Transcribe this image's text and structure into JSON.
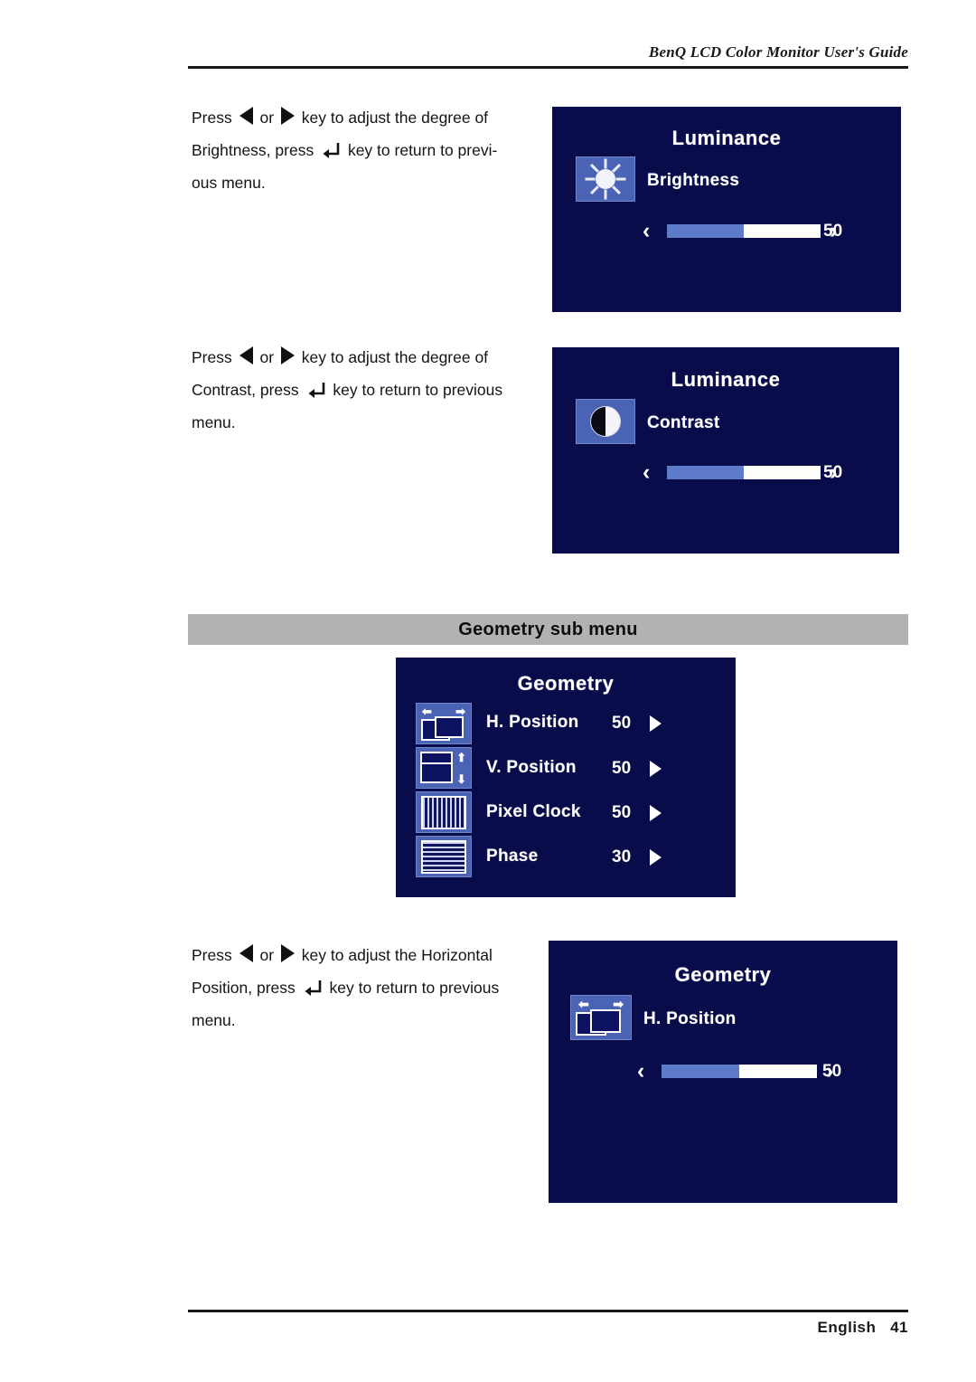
{
  "document": {
    "header_title": "BenQ LCD Color Monitor User's Guide",
    "footer_language": "English",
    "footer_page": "41"
  },
  "section": {
    "banner_title": "Geometry sub menu"
  },
  "instructions": [
    {
      "id": "brightness",
      "line1_before": "Press",
      "left_key": "left-arrow-key",
      "or": "or",
      "right_key": "right-arrow-key",
      "line1_after": "key to adjust the degree of",
      "line2_before": "Brightness, press",
      "return_key": "return-key",
      "line2_after": "key to return to previ-",
      "line3": "ous menu."
    },
    {
      "id": "contrast",
      "line1_before": "Press",
      "left_key": "left-arrow-key",
      "or": "or",
      "right_key": "right-arrow-key",
      "line1_after": "key to adjust the degree of",
      "line2_before": "Contrast, press",
      "return_key": "return-key",
      "line2_after": "key to return to previous",
      "line3": "menu."
    },
    {
      "id": "h-position",
      "line1_before": "Press",
      "left_key": "left-arrow-key",
      "or": "or",
      "right_key": "right-arrow-key",
      "line1_after": "key to adjust the Horizontal",
      "line2_before": "Position, press",
      "return_key": "return-key",
      "line2_after": "key to return to previous",
      "line3": "menu."
    }
  ],
  "osd_panels": [
    {
      "id": "luminance-brightness",
      "title": "Luminance",
      "icon": "brightness-sun-icon",
      "label": "Brightness",
      "value": "50",
      "fill_percent": 50,
      "left_chevron": "‹",
      "right_chevron": "›"
    },
    {
      "id": "luminance-contrast",
      "title": "Luminance",
      "icon": "contrast-half-circle-icon",
      "label": "Contrast",
      "value": "50",
      "fill_percent": 50,
      "left_chevron": "‹",
      "right_chevron": "›"
    },
    {
      "id": "geometry-h-position",
      "title": "Geometry",
      "icon": "h-position-icon",
      "label": "H. Position",
      "value": "50",
      "fill_percent": 50,
      "left_chevron": "‹",
      "right_chevron": "›"
    }
  ],
  "geometry_menu": {
    "title": "Geometry",
    "rows": [
      {
        "icon": "h-position-icon",
        "label": "H. Position",
        "value": "50"
      },
      {
        "icon": "v-position-icon",
        "label": "V. Position",
        "value": "50"
      },
      {
        "icon": "pixel-clock-icon",
        "label": "Pixel Clock",
        "value": "50"
      },
      {
        "icon": "phase-icon",
        "label": "Phase",
        "value": "30"
      }
    ]
  },
  "colors": {
    "osd_background": "#080c4a",
    "osd_text": "#ffffff",
    "icon_tile": "#4b63b4",
    "slider_fill": "#5d7bc9",
    "slider_track": "#fdfdfa",
    "banner_gray": "#b2b2b2",
    "rule_black": "#1a1a1a"
  }
}
